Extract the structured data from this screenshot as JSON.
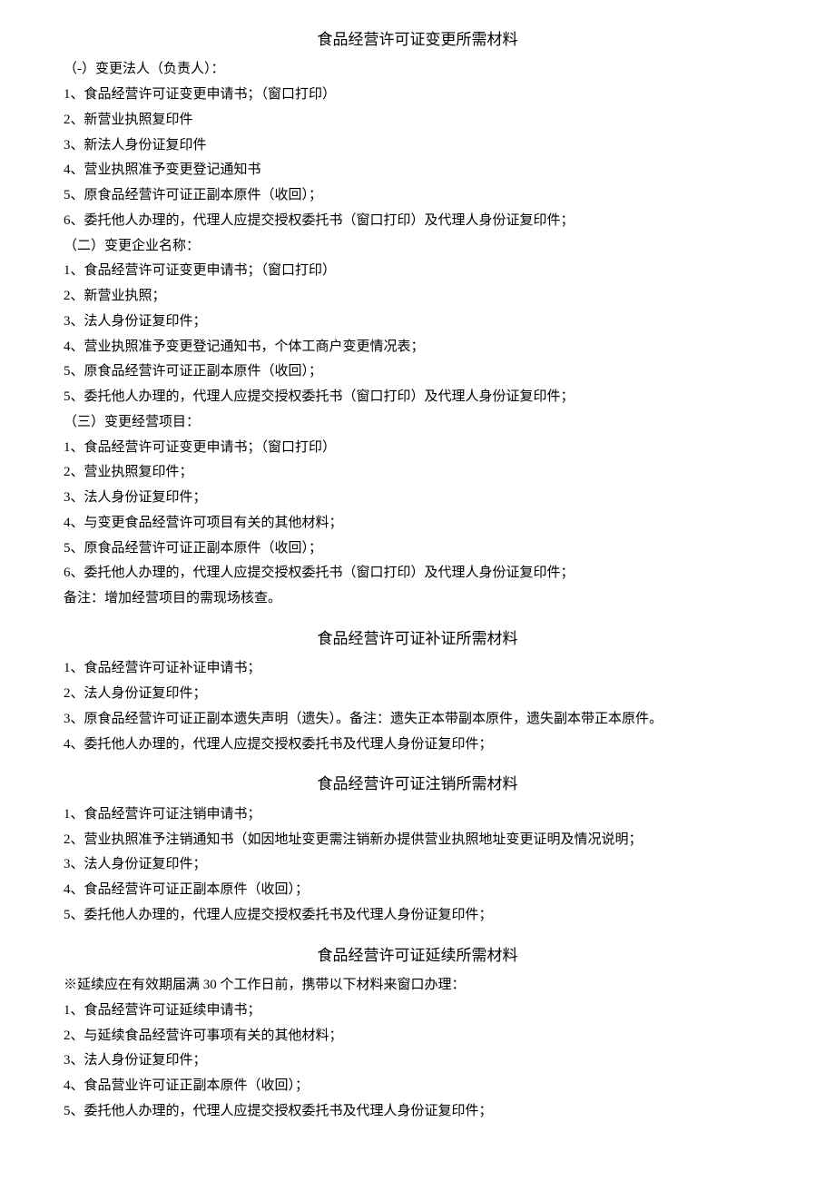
{
  "section1": {
    "title": "食品经营许可证变更所需材料",
    "sub1_header": "（-）变更法人（负责人）：",
    "sub1_items": [
      "1、食品经营许可证变更申请书；（窗口打印）",
      "2、新营业执照复印件",
      "3、新法人身份证复印件",
      "4、营业执照准予变更登记通知书",
      "5、原食品经营许可证正副本原件（收回）；",
      "6、委托他人办理的，代理人应提交授权委托书（窗口打印）及代理人身份证复印件；"
    ],
    "sub2_header": "（二）变更企业名称：",
    "sub2_items": [
      "1、食品经营许可证变更申请书；（窗口打印）",
      "2、新营业执照；",
      "3、法人身份证复印件；",
      "4、营业执照准予变更登记通知书，个体工商户变更情况表；",
      "5、原食品经营许可证正副本原件（收回）；",
      "5、委托他人办理的，代理人应提交授权委托书（窗口打印）及代理人身份证复印件；"
    ],
    "sub3_header": "（三）变更经营项目：",
    "sub3_items": [
      "1、食品经营许可证变更申请书；（窗口打印）",
      "2、营业执照复印件；",
      "3、法人身份证复印件；",
      "4、与变更食品经营许可项目有关的其他材料；",
      "5、原食品经营许可证正副本原件（收回）；",
      "6、委托他人办理的，代理人应提交授权委托书（窗口打印）及代理人身份证复印件；"
    ],
    "note": "备注：增加经营项目的需现场核查。"
  },
  "section2": {
    "title": "食品经营许可证补证所需材料",
    "items": [
      "1、食品经营许可证补证申请书；",
      "2、法人身份证复印件；",
      "3、原食品经营许可证正副本遗失声明（遗失）。备注：遗失正本带副本原件，遗失副本带正本原件。",
      "4、委托他人办理的，代理人应提交授权委托书及代理人身份证复印件；"
    ]
  },
  "section3": {
    "title": "食品经营许可证注销所需材料",
    "items": [
      "1、食品经营许可证注销申请书；",
      "2、营业执照准予注销通知书（如因地址变更需注销新办提供营业执照地址变更证明及情况说明；",
      "3、法人身份证复印件；",
      "4、食品经营许可证正副本原件（收回）；",
      "5、委托他人办理的，代理人应提交授权委托书及代理人身份证复印件；"
    ]
  },
  "section4": {
    "title": "食品经营许可证延续所需材料",
    "preface": "※延续应在有效期届满 30 个工作日前，携带以下材料来窗口办理：",
    "items": [
      "1、食品经营许可证延续申请书；",
      "2、与延续食品经营许可事项有关的其他材料；",
      "3、法人身份证复印件；",
      "4、食品营业许可证正副本原件（收回）；",
      "5、委托他人办理的，代理人应提交授权委托书及代理人身份证复印件；"
    ]
  }
}
